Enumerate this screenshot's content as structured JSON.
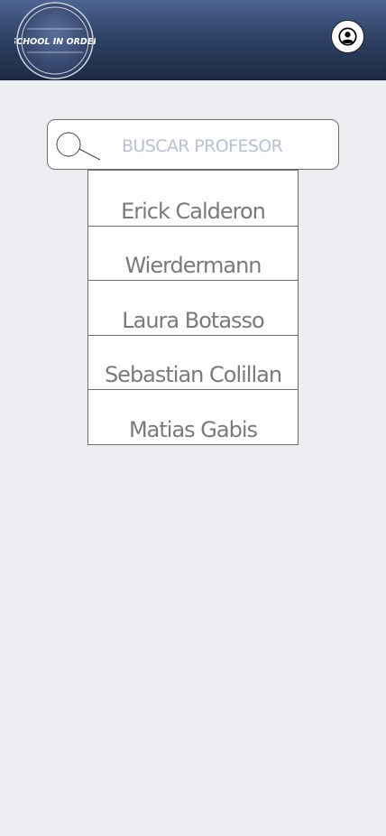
{
  "header": {
    "logo_text": "SCHOOL IN ORDER",
    "profile_icon": "user-circle-icon",
    "gradient_colors": [
      "#4E6494",
      "#1D2A42"
    ]
  },
  "search": {
    "placeholder": "BUSCAR PROFESOR",
    "value": "",
    "icon": "magnifier-icon"
  },
  "teachers": [
    {
      "name": "Erick Calderon"
    },
    {
      "name": "Wierdermann"
    },
    {
      "name": "Laura Botasso"
    },
    {
      "name": "Sebastian Colillan"
    },
    {
      "name": "Matias Gabis"
    }
  ],
  "colors": {
    "background": "#ECEDF1",
    "list_text": "#7a7a7a",
    "placeholder": "#b9c1d0"
  }
}
